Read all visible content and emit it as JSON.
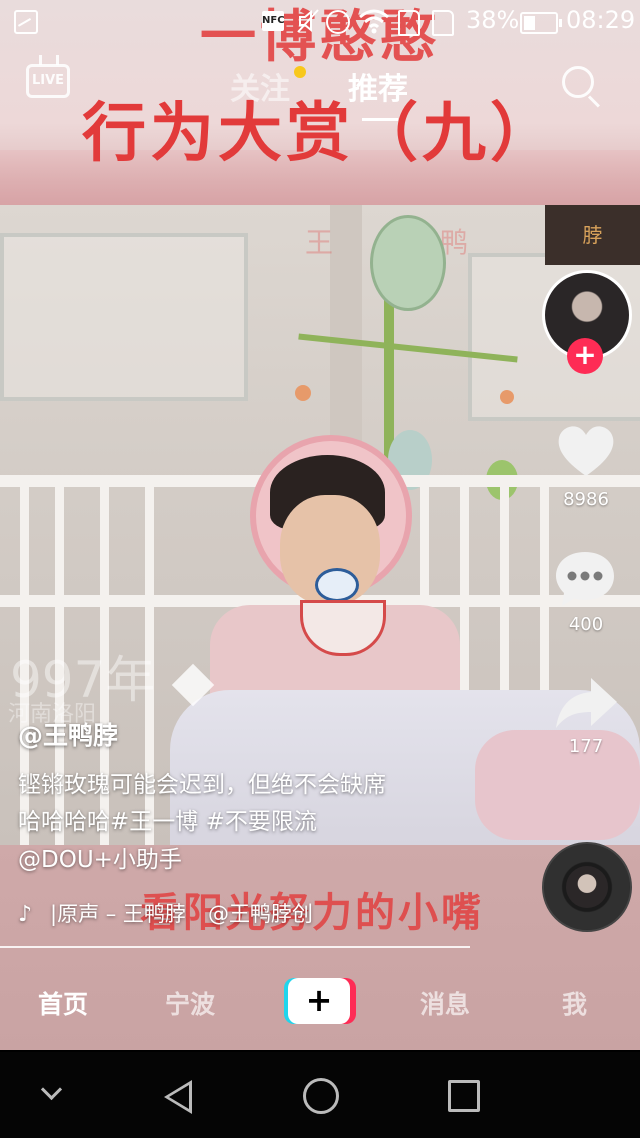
{
  "status_bar": {
    "battery_percent": "38%",
    "battery_level": 0.38,
    "time": "08:29",
    "nfc_label": "NFC",
    "icons": [
      "gallery-icon",
      "nfc-icon",
      "mute-icon",
      "alarm-icon",
      "wifi-icon",
      "sim1-icon",
      "sim2-icon",
      "battery-icon"
    ]
  },
  "top_nav": {
    "live_label": "LIVE",
    "tabs": [
      {
        "label": "关注",
        "active": false,
        "has_dot": true
      },
      {
        "label": "推荐",
        "active": true
      }
    ]
  },
  "video": {
    "banner_top_line_1": "一博憨憨",
    "banner_top_line_2": "行为大赏（九）",
    "sign_text": "脖",
    "watermark_wang": "王",
    "watermark_ya": "鸭",
    "year_overlay": "997年",
    "city_overlay": "河南洛阳",
    "banner_bottom": "看阳光努力的小嘴"
  },
  "actions": {
    "like_count": "8986",
    "comment_count": "400",
    "share_count": "177",
    "follow_plus": "+"
  },
  "caption": {
    "author": "@王鸭脖",
    "lines": [
      "铿锵玫瑰可能会迟到，但绝不会缺席",
      "哈哈哈哈#王一博 #不要限流",
      "@DOU+小助手"
    ],
    "music_text": "|原声 – 王鸭脖",
    "music_author": "@王鸭脖创"
  },
  "bottom_nav": {
    "items": [
      "首页",
      "宁波",
      "+",
      "消息",
      "我"
    ],
    "active": "首页"
  },
  "colors": {
    "accent_red": "#fe2c55",
    "accent_cyan": "#20d5ec",
    "follow_dot": "#f8c81c"
  }
}
